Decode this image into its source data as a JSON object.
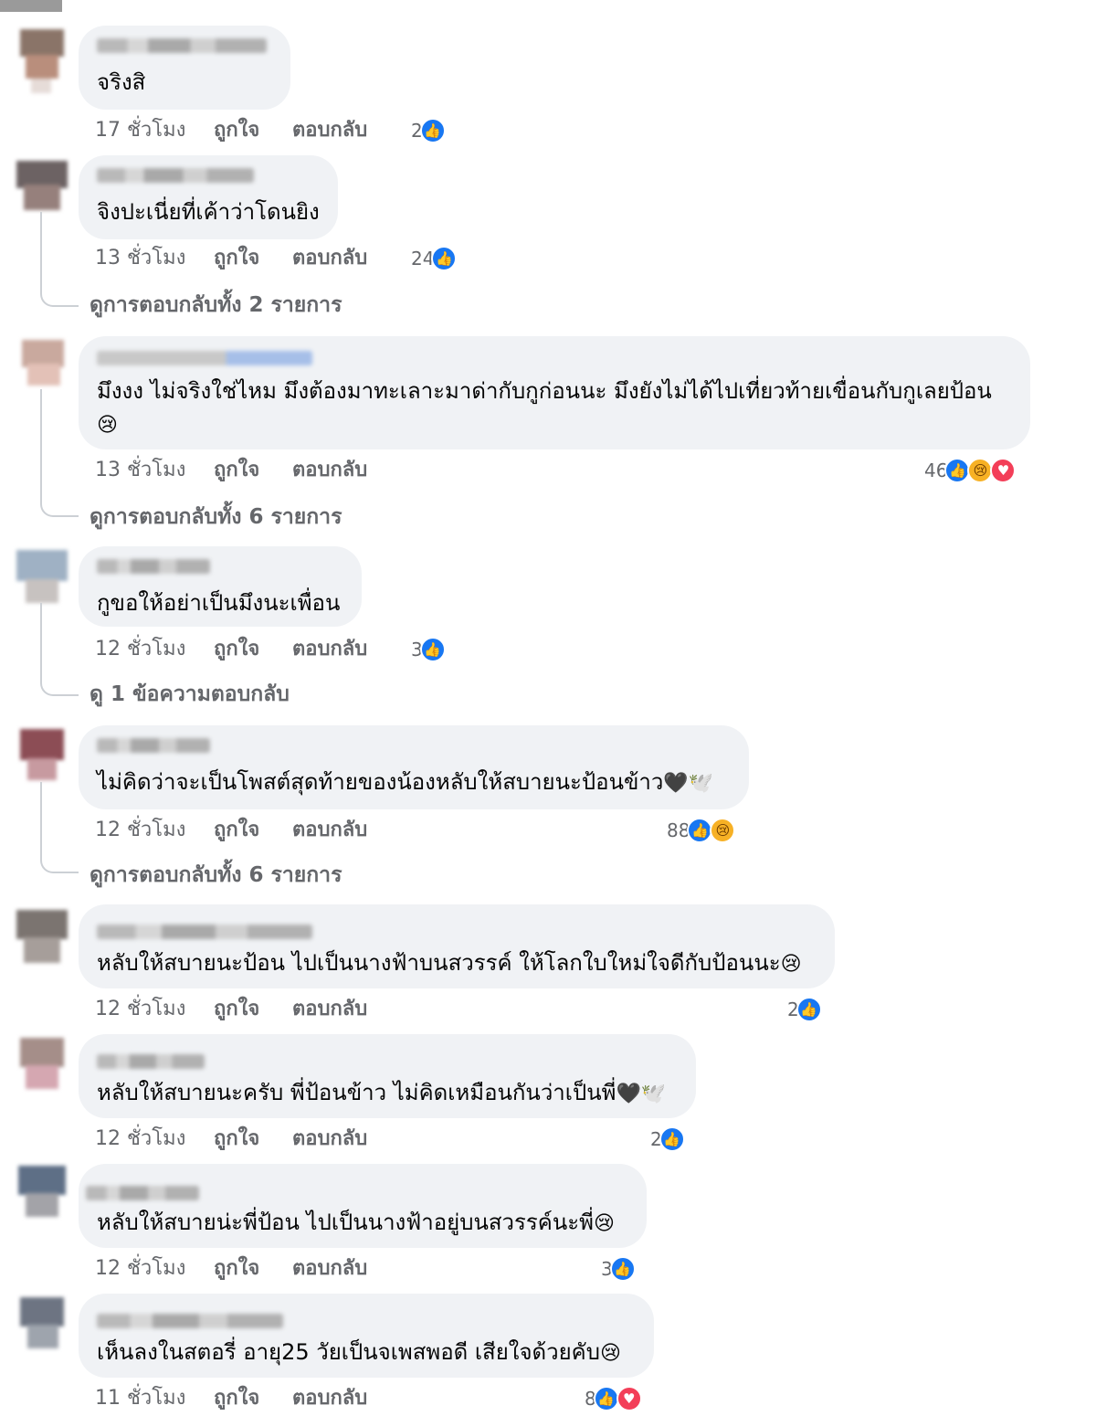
{
  "actions": {
    "like": "ถูกใจ",
    "reply": "ตอบกลับ"
  },
  "icons": {
    "like": "like-icon",
    "sad": "sad-icon",
    "love": "love-icon"
  },
  "colors": {
    "like": "#1877f2",
    "sad": "#f7b125",
    "love": "#f33e58",
    "bubble": "#f0f2f5",
    "meta": "#65676b"
  },
  "comments": [
    {
      "text": "จริงสิ",
      "time": "17 ชั่วโมง",
      "reaction_count": "2"
    },
    {
      "text": "จิงปะเนี่ยที่เค้าว่าโดนยิง",
      "time": "13 ชั่วโมง",
      "reaction_count": "24",
      "view_replies": "ดูการตอบกลับทั้ง 2 รายการ"
    },
    {
      "text": "มึงงง ไม่จริงใช่ไหม มึงต้องมาทะเลาะมาด่ากับกูก่อนนะ มึงยังไม่ได้ไปเที่ยวท้ายเขื่อนกับกูเลยป้อน",
      "emoji": "😢",
      "time": "13 ชั่วโมง",
      "reaction_count": "46",
      "view_replies": "ดูการตอบกลับทั้ง 6 รายการ"
    },
    {
      "text": "กูขอให้อย่าเป็นมึงนะเพื่อน",
      "time": "12 ชั่วโมง",
      "reaction_count": "3",
      "view_replies": "ดู 1 ข้อความตอบกลับ"
    },
    {
      "text": "ไม่คิดว่าจะเป็นโพสต์สุดท้ายของน้องหลับให้สบายนะป้อนข้าว",
      "emoji": "🖤🕊️",
      "time": "12 ชั่วโมง",
      "reaction_count": "88",
      "view_replies": "ดูการตอบกลับทั้ง 6 รายการ"
    },
    {
      "text": "หลับให้สบายนะป้อน ไปเป็นนางฟ้าบนสวรรค์ ให้โลกใบใหม่ใจดีกับป้อนนะ",
      "emoji": "😢",
      "time": "12 ชั่วโมง",
      "reaction_count": "2"
    },
    {
      "text": "หลับให้สบายนะครับ พี่ป้อนข้าว ไม่คิดเหมือนกันว่าเป็นพี่",
      "emoji": "🖤🕊️",
      "time": "12 ชั่วโมง",
      "reaction_count": "2"
    },
    {
      "text": "หลับให้สบายน่ะพี่ป้อน ไปเป็นนางฟ้าอยู่บนสวรรค์นะพี่",
      "emoji": "😢",
      "time": "12 ชั่วโมง",
      "reaction_count": "3"
    },
    {
      "text": "เห็นลงในสตอรี่ อายุ25 วัยเป็นจเพสพอดี เสียใจด้วยคับ",
      "emoji": "😢",
      "time": "11 ชั่วโมง",
      "reaction_count": "8"
    }
  ]
}
